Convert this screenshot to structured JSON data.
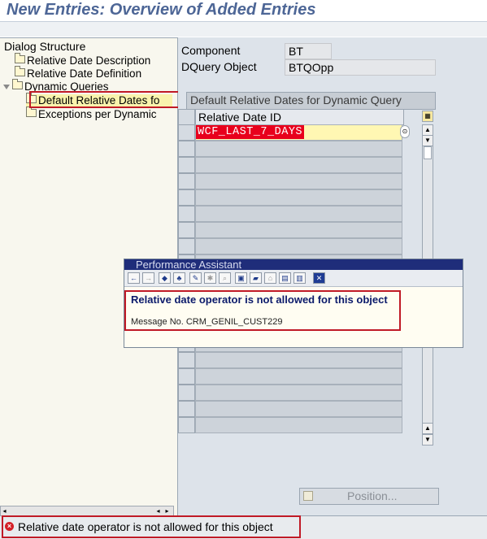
{
  "window": {
    "title": "New Entries: Overview of Added Entries"
  },
  "dialog_structure": {
    "title": "Dialog Structure",
    "items": [
      {
        "label": "Relative Date Description",
        "level": 1
      },
      {
        "label": "Relative Date Definition",
        "level": 1
      },
      {
        "label": "Dynamic Queries",
        "level": 0,
        "expanded": true
      },
      {
        "label": "Default Relative Dates fo",
        "level": 2,
        "selected": true
      },
      {
        "label": "Exceptions per Dynamic",
        "level": 2
      }
    ]
  },
  "header_fields": {
    "component_label": "Component",
    "component_value": "BT",
    "dquery_label": "DQuery Object",
    "dquery_value": "BTQOpp"
  },
  "table": {
    "title": "Default Relative Dates for Dynamic Query",
    "column_header": "Relative Date ID",
    "rows": [
      "WCF_LAST_7_DAYS"
    ]
  },
  "popup": {
    "title": "Performance Assistant",
    "message": "Relative date operator is not allowed for this object",
    "message_no": "Message No. CRM_GENIL_CUST229"
  },
  "position_button": {
    "label": "Position..."
  },
  "status_bar": {
    "type": "error",
    "text": "Relative date operator is not allowed for this object"
  },
  "colors": {
    "title_text": "#4d6696",
    "error_highlight": "#c01a26",
    "cell_error_bg": "#e8001c",
    "popup_title_bar": "#1f2d7a"
  }
}
